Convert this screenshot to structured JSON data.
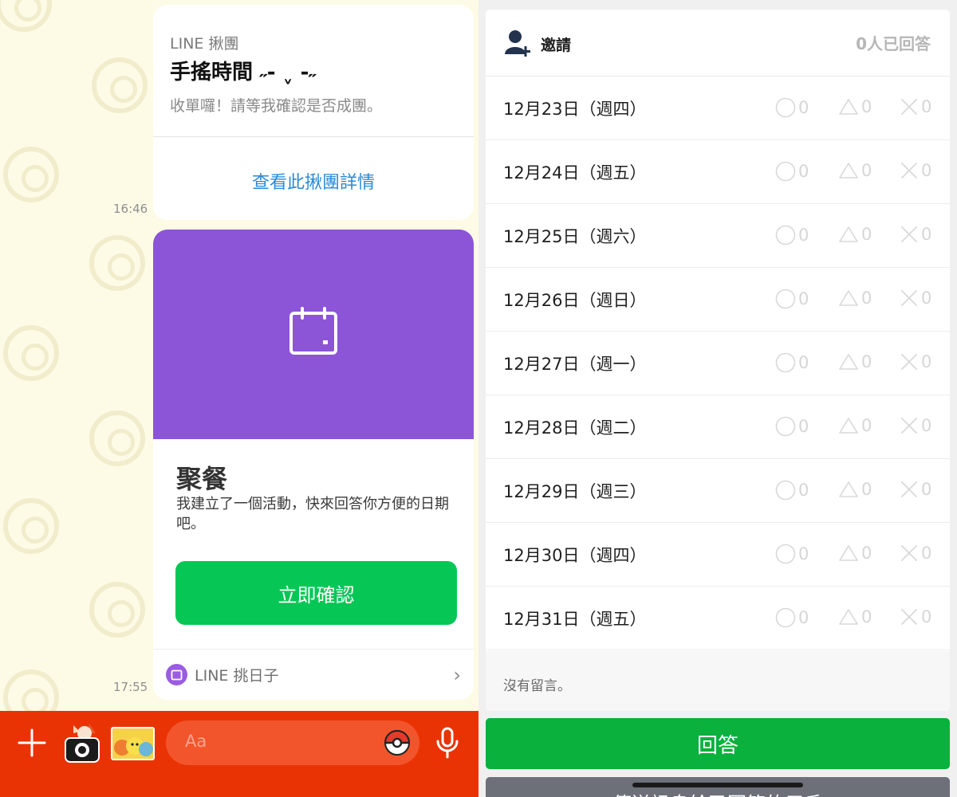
{
  "left": {
    "group_buy_card": {
      "brand": "LINE 揪團",
      "title": "手搖時間 ˶- ˬ -˶",
      "subtitle": "收單囉！請等我確認是否成團。",
      "details_link": "查看此揪團詳情"
    },
    "time1": "16:46",
    "event_card": {
      "title": "聚餐",
      "description": "我建立了一個活動，快來回答你方便的日期吧。",
      "confirm_button": "立即確認",
      "app_name": "LINE 挑日子",
      "banner_color": "#8c55d8"
    },
    "time2": "17:55",
    "input_placeholder": "Aa",
    "icons": {
      "plus": "plus-icon",
      "camera": "camera-icon",
      "sticker": "sticker-icon",
      "pokeball": "pokeball-icon",
      "mic": "microphone-icon"
    },
    "colors": {
      "toolbar": "#ea3305",
      "chat_bg": "#fdfbe6",
      "confirm": "#06c755"
    }
  },
  "right": {
    "header": {
      "title": "邀請",
      "answered_count": "0人已回答"
    },
    "dates": [
      {
        "label": "12月23日（週四）",
        "yes": "0",
        "maybe": "0",
        "no": "0"
      },
      {
        "label": "12月24日（週五）",
        "yes": "0",
        "maybe": "0",
        "no": "0"
      },
      {
        "label": "12月25日（週六）",
        "yes": "0",
        "maybe": "0",
        "no": "0"
      },
      {
        "label": "12月26日（週日）",
        "yes": "0",
        "maybe": "0",
        "no": "0"
      },
      {
        "label": "12月27日（週一）",
        "yes": "0",
        "maybe": "0",
        "no": "0"
      },
      {
        "label": "12月28日（週二）",
        "yes": "0",
        "maybe": "0",
        "no": "0"
      },
      {
        "label": "12月29日（週三）",
        "yes": "0",
        "maybe": "0",
        "no": "0"
      },
      {
        "label": "12月30日（週四）",
        "yes": "0",
        "maybe": "0",
        "no": "0"
      },
      {
        "label": "12月31日（週五）",
        "yes": "0",
        "maybe": "0",
        "no": "0"
      }
    ],
    "no_comments": "沒有留言。",
    "answer_button": "回答",
    "bottom_button_partial": "傳送訊息給已回答的用戶",
    "colors": {
      "answer": "#0ab13c"
    }
  }
}
